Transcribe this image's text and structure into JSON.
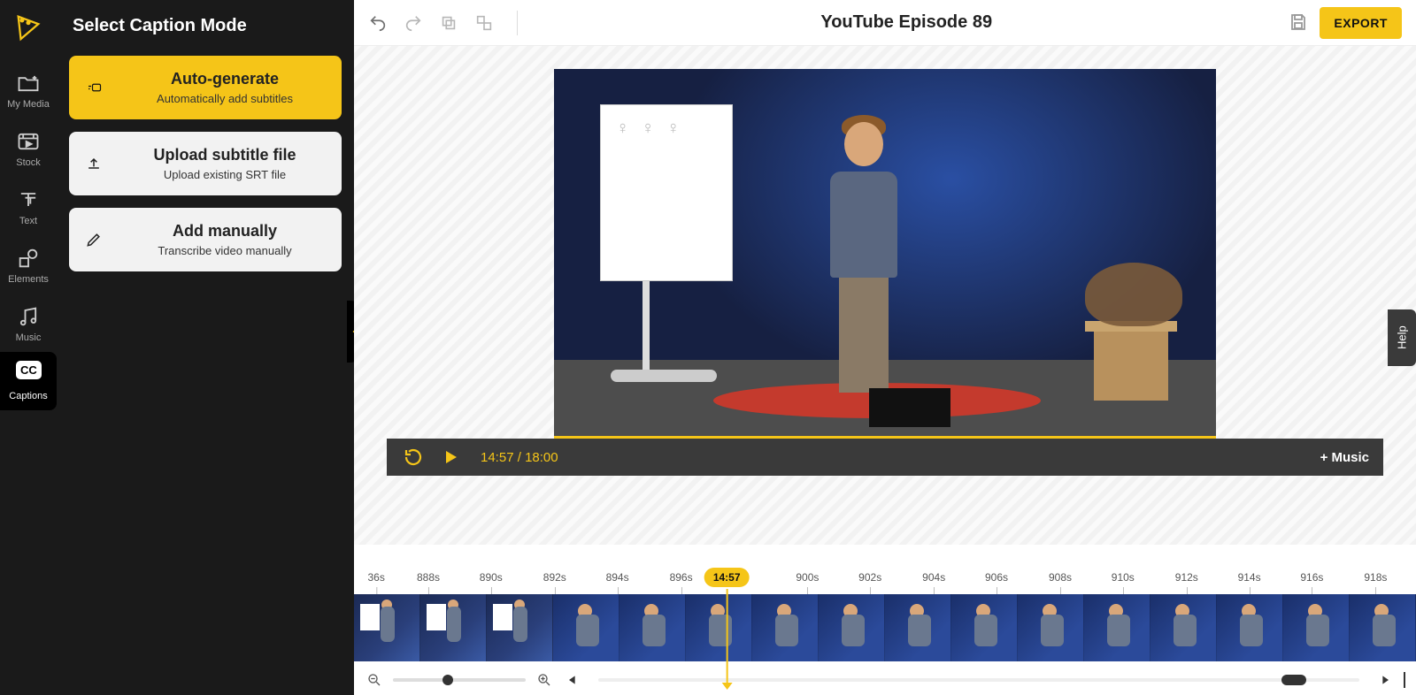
{
  "nav": {
    "items": [
      {
        "id": "my-media",
        "label": "My Media"
      },
      {
        "id": "stock",
        "label": "Stock"
      },
      {
        "id": "text",
        "label": "Text"
      },
      {
        "id": "elements",
        "label": "Elements"
      },
      {
        "id": "music",
        "label": "Music"
      },
      {
        "id": "captions",
        "label": "Captions"
      }
    ],
    "cc_badge": "CC"
  },
  "panel": {
    "title": "Select Caption Mode",
    "modes": [
      {
        "title": "Auto-generate",
        "sub": "Automatically add subtitles"
      },
      {
        "title": "Upload subtitle file",
        "sub": "Upload existing SRT file"
      },
      {
        "title": "Add manually",
        "sub": "Transcribe video manually"
      }
    ]
  },
  "header": {
    "title": "YouTube Episode 89",
    "export": "EXPORT"
  },
  "player": {
    "current": "14:57",
    "total": "18:00",
    "separator": " / ",
    "add_music": "+ Music"
  },
  "timeline": {
    "playhead": "14:57",
    "ticks": [
      "36s",
      "888s",
      "890s",
      "892s",
      "894s",
      "896s",
      "",
      "900s",
      "902s",
      "904s",
      "906s",
      "908s",
      "910s",
      "912s",
      "914s",
      "916s",
      "918s"
    ]
  },
  "help": {
    "label": "Help"
  }
}
